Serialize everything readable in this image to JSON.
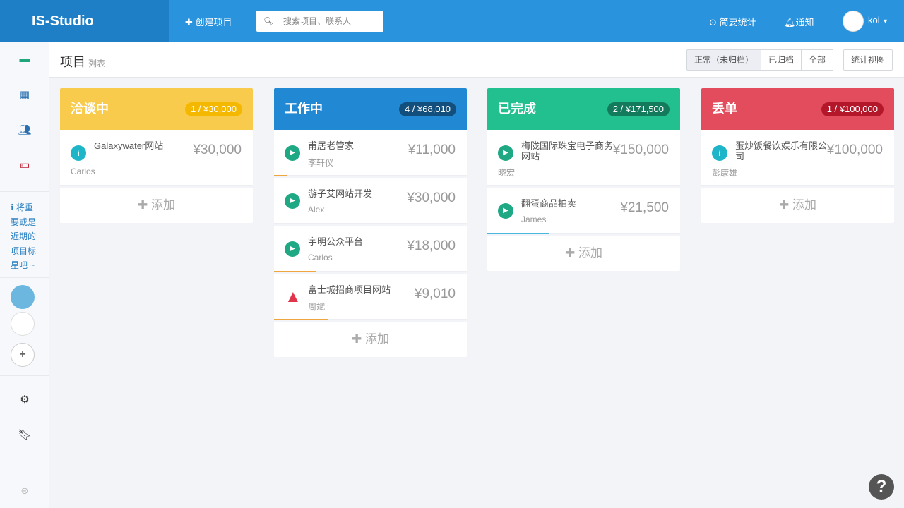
{
  "header": {
    "brand": "IS-Studio",
    "create": "创建项目",
    "search_placeholder": "搜索项目、联系人",
    "stats": "简要统计",
    "notify": "通知",
    "user": "koi"
  },
  "sidebar": {
    "tip": "将重要或是近期的项目标星吧 ~"
  },
  "page": {
    "title": "项目",
    "subtitle": "列表",
    "filters": [
      "正常（未归档）",
      "已归档",
      "全部"
    ],
    "stat_view": "统计视图"
  },
  "add_label": "添加",
  "columns": [
    {
      "title": "洽谈中",
      "badge": "1 / ¥30,000",
      "color": "#f8cb4c",
      "badge_color": "#f5b800",
      "cards": [
        {
          "name": "Galaxywater网站",
          "owner": "Carlos",
          "amount": "¥30,000",
          "status": "info",
          "progress": 0
        }
      ]
    },
    {
      "title": "工作中",
      "badge": "4 / ¥68,010",
      "color": "#2188d3",
      "badge_color": "#134f7c",
      "cards": [
        {
          "name": "甫居老管家",
          "owner": "李轩仪",
          "amount": "¥11,000",
          "status": "play",
          "progress": 7
        },
        {
          "name": "游子艾网站开发",
          "owner": "Alex",
          "amount": "¥30,000",
          "status": "play",
          "progress": 0
        },
        {
          "name": "宇明公众平台",
          "owner": "Carlos",
          "amount": "¥18,000",
          "status": "play",
          "progress": 22
        },
        {
          "name": "富士城招商项目网站",
          "owner": "周斌",
          "amount": "¥9,010",
          "status": "warning",
          "progress": 28
        }
      ]
    },
    {
      "title": "已完成",
      "badge": "2 / ¥171,500",
      "color": "#22c08f",
      "badge_color": "#137a5b",
      "cards": [
        {
          "name": "梅陇国际珠宝电子商务网站",
          "owner": "晓宏",
          "amount": "¥150,000",
          "status": "play",
          "progress": 0
        },
        {
          "name": "翻蛋商品拍卖",
          "owner": "James",
          "amount": "¥21,500",
          "status": "play",
          "progress": 32
        }
      ]
    },
    {
      "title": "丢单",
      "badge": "1 / ¥100,000",
      "color": "#e24c5c",
      "badge_color": "#b5172a",
      "cards": [
        {
          "name": "蛋炒饭餐饮娱乐有限公司",
          "owner": "彭康雄",
          "amount": "¥100,000",
          "status": "info",
          "progress": 0
        }
      ]
    }
  ]
}
